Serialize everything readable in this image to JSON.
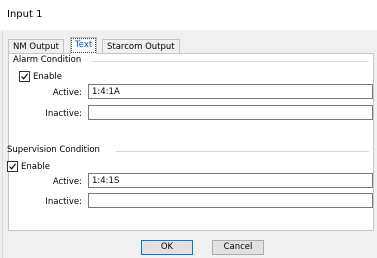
{
  "window": {
    "title": "Input 1"
  },
  "tabs": [
    {
      "label": "NM Output"
    },
    {
      "label": "Text"
    },
    {
      "label": "Starcom Output"
    }
  ],
  "alarm": {
    "group_label": "Alarm Condition",
    "enable_label": "Enable",
    "enabled": true,
    "active_label": "Active:",
    "active_value": "1:4:1A",
    "inactive_label": "Inactive:",
    "inactive_value": ""
  },
  "supervision": {
    "group_label": "Supervision Condition",
    "enable_label": "Enable",
    "enabled": true,
    "active_label": "Active:",
    "active_value": "1:4:1S",
    "inactive_label": "Inactive:",
    "inactive_value": ""
  },
  "buttons": {
    "ok": "OK",
    "cancel": "Cancel"
  },
  "colors": {
    "active_tab_text": "#0b57d0",
    "default_button_border": "#0078d7"
  }
}
